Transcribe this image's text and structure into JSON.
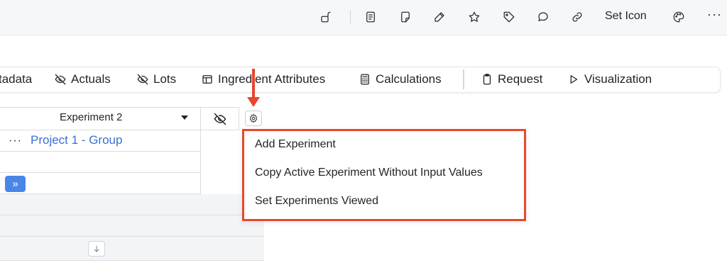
{
  "toolbar": {
    "icons": [
      "lock-open-icon",
      "document-icon",
      "sticky-note-icon",
      "pen-icon",
      "star-icon",
      "tag-icon",
      "comment-icon",
      "link-icon",
      "palette-icon"
    ],
    "set_icon_label": "Set Icon",
    "more_label": "···"
  },
  "nav": {
    "items": [
      {
        "label": "tadata",
        "icon": "none"
      },
      {
        "label": "Actuals",
        "icon": "eye-off-icon"
      },
      {
        "label": "Lots",
        "icon": "eye-off-icon"
      },
      {
        "label": "Ingredient Attributes",
        "icon": "table-icon"
      },
      {
        "label": "Calculations",
        "icon": "calculator-icon"
      },
      {
        "label": "Request",
        "icon": "clipboard-icon"
      },
      {
        "label": "Visualization",
        "icon": "play-icon"
      }
    ]
  },
  "grid": {
    "experiment_select": "Experiment 2",
    "row_menu": "···",
    "project_label": "Project 1 - Group",
    "expand_label": "»"
  },
  "menu": {
    "items": [
      "Add Experiment",
      "Copy Active Experiment Without Input Values",
      "Set Experiments Viewed"
    ]
  },
  "colors": {
    "annotation": "#e8472e",
    "link": "#3a6fd1",
    "primary_button": "#4a86e8"
  }
}
